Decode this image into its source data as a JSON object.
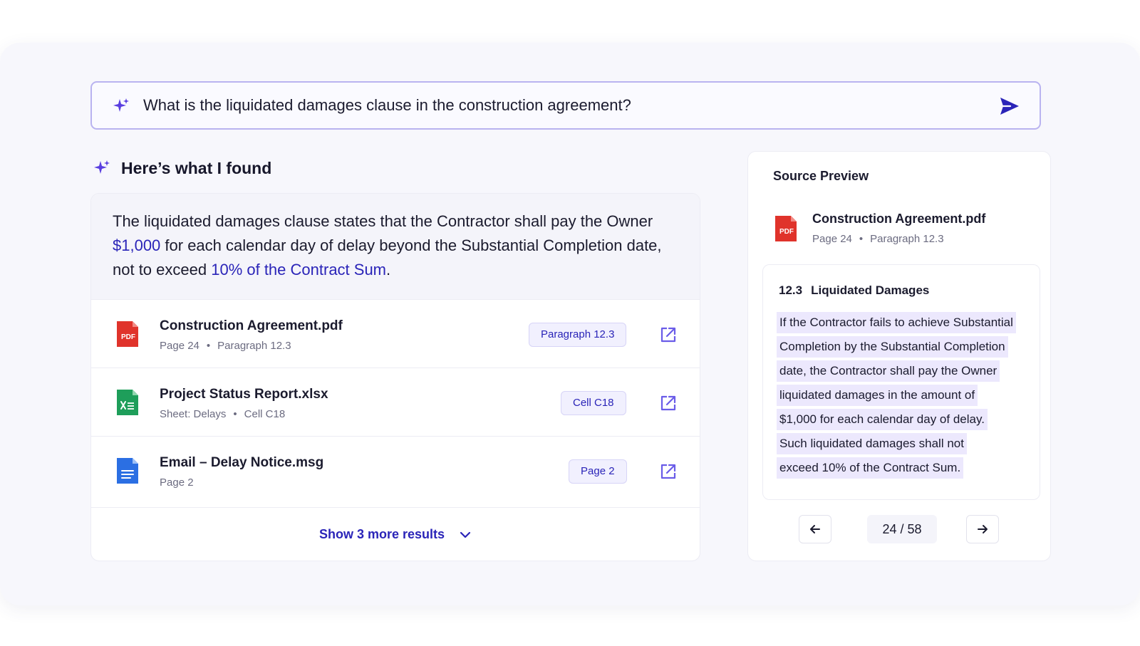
{
  "search": {
    "query": "What is the liquidated damages clause in the construction agreement?",
    "spark_icon": "sparkles-icon",
    "send_icon": "send-icon"
  },
  "results": {
    "heading": "Here’s what I found",
    "answer": {
      "part1": "The liquidated damages clause states that the Contractor shall pay the Owner ",
      "highlight1": "$1,000",
      "part2": " for each calendar day of delay beyond the Substantial Completion date, not to exceed ",
      "highlight2": "10% of the Contract Sum",
      "part3": "."
    },
    "items": [
      {
        "name": "Construction Agreement.pdf",
        "meta_a": "Page 24",
        "meta_b": "Paragraph 12.3",
        "chip": "Paragraph 12.3",
        "icon": "pdf-file-icon"
      },
      {
        "name": "Project Status Report.xlsx",
        "meta_a": "Sheet: Delays",
        "meta_b": "Cell C18",
        "chip": "Cell C18",
        "icon": "spreadsheet-file-icon"
      },
      {
        "name": "Email – Delay Notice.msg",
        "meta_a": "Page 2",
        "chip": "Page 2",
        "icon": "document-file-icon"
      }
    ],
    "show_more": "Show 3 more results"
  },
  "preview": {
    "title": "Source Preview",
    "file_name": "Construction Agreement.pdf",
    "file_meta_a": "Page 24",
    "file_meta_b": "Paragraph 12.3",
    "section_number": "12.3",
    "section_title": "Liquidated Damages",
    "lines": [
      "If the Contractor fails to achieve Substantial",
      "Completion by the Substantial Completion",
      "date, the Contractor shall pay the Owner",
      "liquidated damages in the amount of",
      "$1,000 for each calendar day of delay.",
      "Such liquidated damages shall not",
      "exceed 10% of the Contract Sum."
    ],
    "page_indicator": "24 / 58"
  },
  "colors": {
    "accent": "#2a24b8",
    "highlight_bg": "#ece8fd",
    "pdf_red": "#e0332b",
    "sheet_green": "#1e9e5a",
    "doc_blue": "#2b6fe3"
  }
}
